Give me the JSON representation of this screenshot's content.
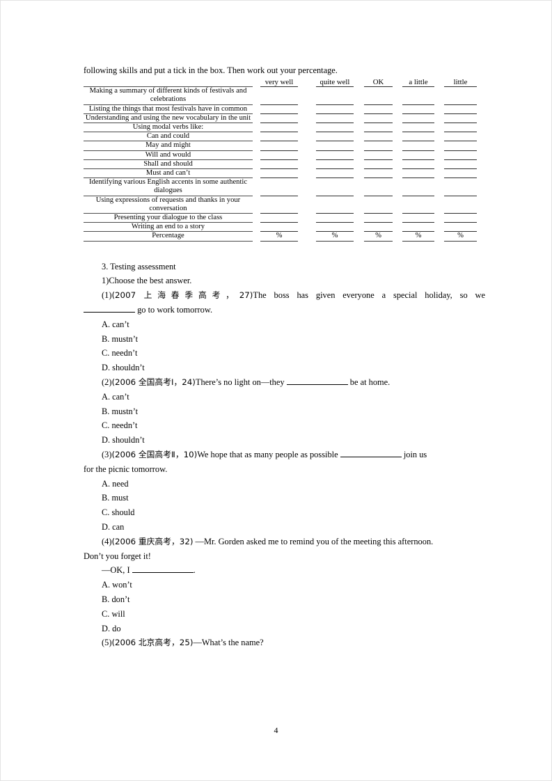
{
  "document": {
    "page_number": "4",
    "intro_line": "following skills and put a tick in the box. Then work out your percentage."
  },
  "assessment_table": {
    "column_headers": [
      "very well",
      "quite well",
      "OK",
      "a little",
      "little"
    ],
    "rows": [
      "Making a summary of different kinds of festivals and celebrations",
      "Listing the things that most festivals have in common",
      "Understanding and using the new vocabulary in the unit",
      "Using modal verbs like:",
      "Can and could",
      "May and might",
      "Will and would",
      "Shall and should",
      "Must and can’t",
      "Identifying various English accents in some authentic dialogues",
      "Using expressions of requests and thanks in your conversation",
      "Presenting your dialogue to the class",
      "Writing an end to a story"
    ],
    "footer_label": "Percentage",
    "footer_values": [
      "%",
      "%",
      "%",
      "%",
      "%"
    ]
  },
  "section": {
    "heading": "3. Testing assessment",
    "subheading": "1)Choose the best answer."
  },
  "questions": [
    {
      "number": "(1)",
      "source": "(2007 上海春季高考，27)",
      "stem_part1": "The boss has given everyone a special holiday, so we",
      "stem_part2": "go to work tomorrow.",
      "options": [
        "A. can’t",
        "B. mustn’t",
        "C. needn’t",
        "D. shouldn’t"
      ]
    },
    {
      "number": "(2)",
      "source": "(2006 全国高考Ⅰ，24)",
      "stem_part1": "There’s no light on—they",
      "stem_part2": "be at home.",
      "options": [
        "A. can’t",
        "B. mustn’t",
        "C. needn’t",
        "D. shouldn’t"
      ]
    },
    {
      "number": "(3)",
      "source": "(2006 全国高考Ⅱ，10)",
      "stem_part1": "We hope that as many people as possible",
      "stem_part2": "join us",
      "stem_part3": "for the picnic tomorrow.",
      "options": [
        "A. need",
        "B. must",
        "C. should",
        "D. can"
      ]
    },
    {
      "number": "(4)",
      "source": "(2006 重庆高考，32)",
      "stem_part1": "—Mr. Gorden asked me to remind you of the meeting this afternoon.",
      "stem_part2": "Don’t you forget it!",
      "stem_part3": "—OK, I",
      "stem_part4": ".",
      "options": [
        "A. won’t",
        "B. don’t",
        "C. will",
        "D. do"
      ]
    },
    {
      "number": "(5)",
      "source": "(2006 北京高考，25)",
      "stem_part1": "—What’s the name?",
      "options": []
    }
  ]
}
